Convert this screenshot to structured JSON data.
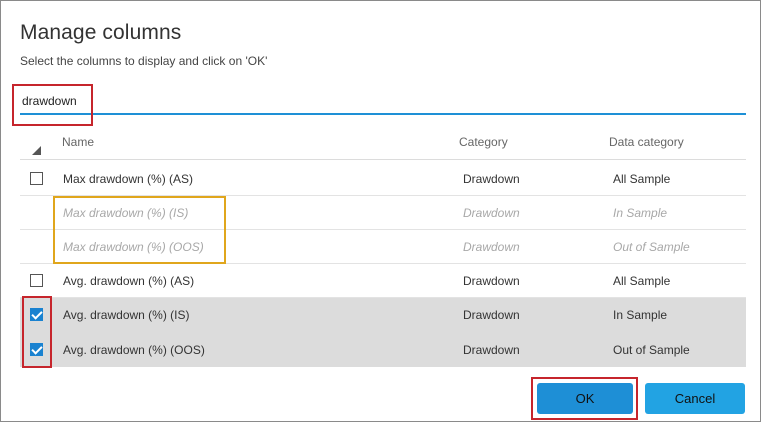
{
  "dialog": {
    "title": "Manage columns",
    "subtitle": "Select the columns to display and click on 'OK'"
  },
  "search": {
    "value": "drawdown",
    "placeholder": ""
  },
  "table": {
    "headers": {
      "name": "Name",
      "category": "Category",
      "data_category": "Data category"
    },
    "rows": [
      {
        "name": "Max drawdown (%) (AS)",
        "category": "Drawdown",
        "data_category": "All Sample",
        "checked": false,
        "disabled": false
      },
      {
        "name": "Max drawdown (%) (IS)",
        "category": "Drawdown",
        "data_category": "In Sample",
        "checked": false,
        "disabled": true
      },
      {
        "name": "Max drawdown (%) (OOS)",
        "category": "Drawdown",
        "data_category": "Out of Sample",
        "checked": false,
        "disabled": true
      },
      {
        "name": "Avg. drawdown (%) (AS)",
        "category": "Drawdown",
        "data_category": "All Sample",
        "checked": false,
        "disabled": false
      },
      {
        "name": "Avg. drawdown (%) (IS)",
        "category": "Drawdown",
        "data_category": "In Sample",
        "checked": true,
        "disabled": false
      },
      {
        "name": "Avg. drawdown (%) (OOS)",
        "category": "Drawdown",
        "data_category": "Out of Sample",
        "checked": true,
        "disabled": false
      }
    ]
  },
  "buttons": {
    "ok": "OK",
    "cancel": "Cancel"
  },
  "colors": {
    "accent": "#1e90d6",
    "button": "#22a3e3",
    "highlight_red": "#c6252c",
    "highlight_orange": "#e0a61c"
  }
}
